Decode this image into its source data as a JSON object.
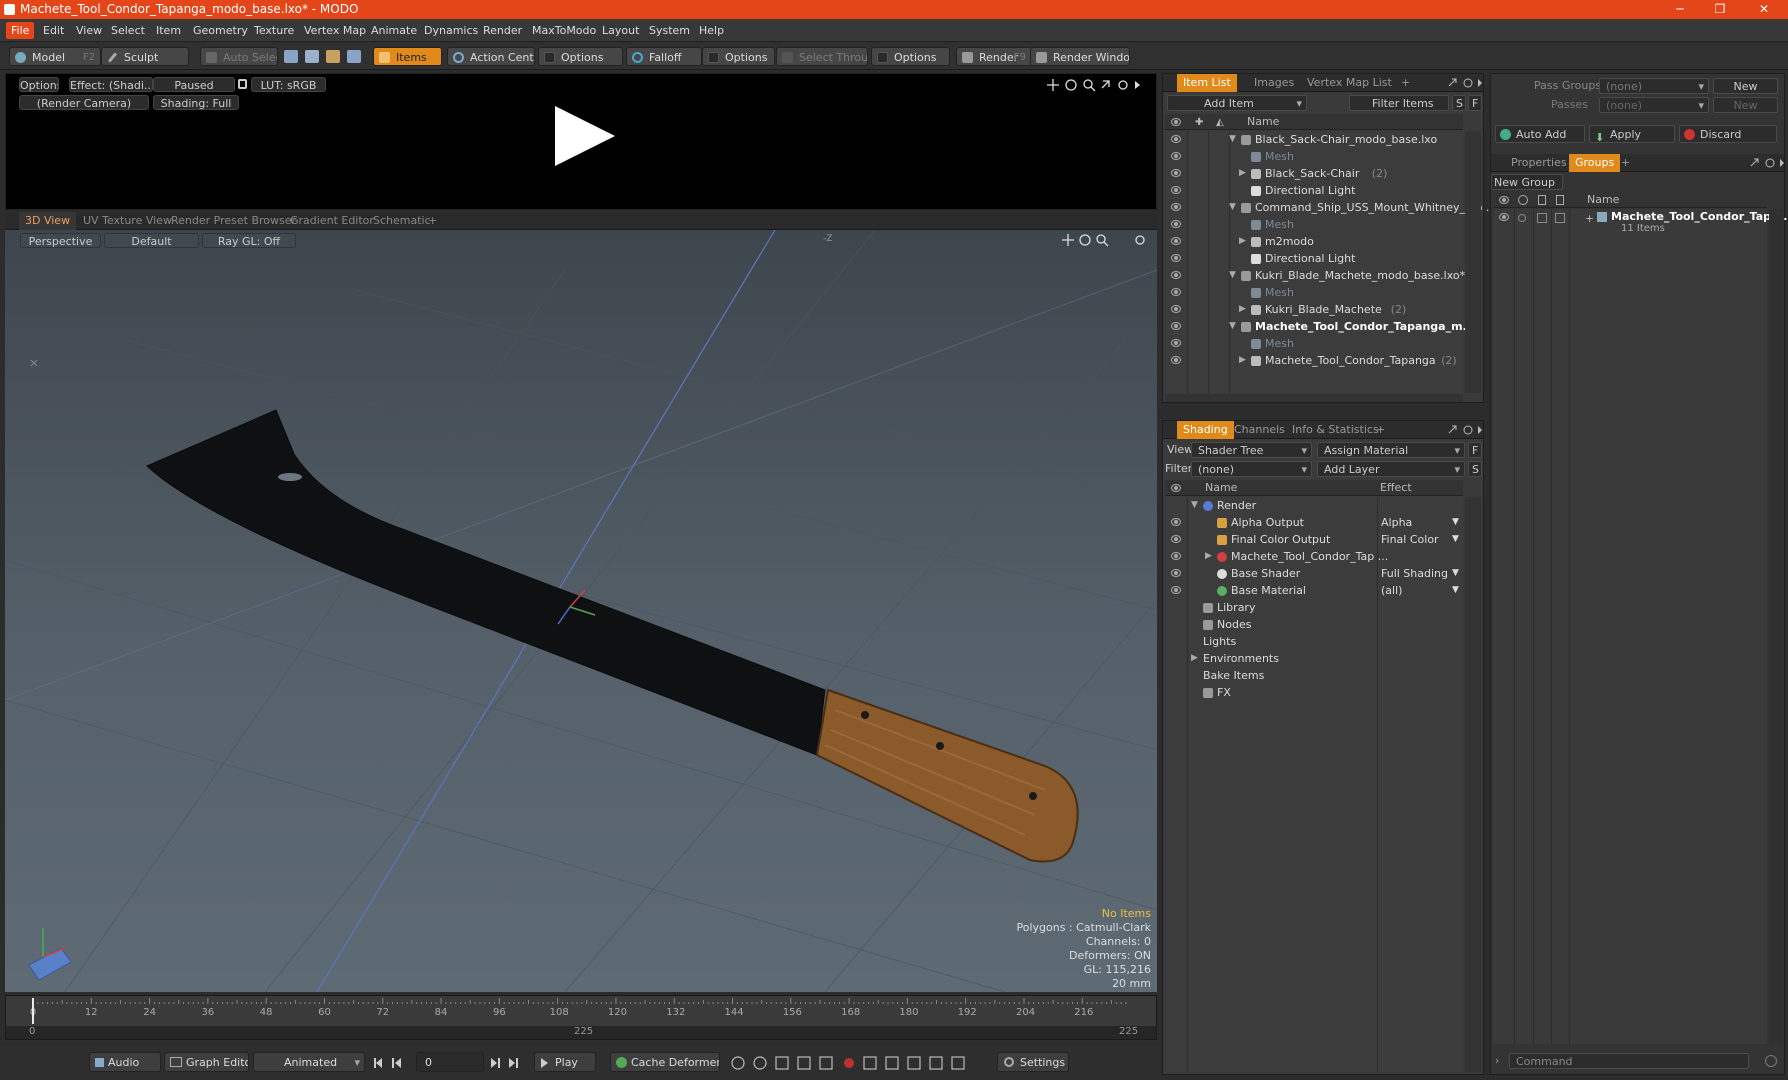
{
  "window": {
    "title": "Machete_Tool_Condor_Tapanga_modo_base.lxo* - MODO",
    "minimize": "─",
    "maximize": "❐",
    "close": "✕"
  },
  "menu": [
    "File",
    "Edit",
    "View",
    "Select",
    "Item",
    "Geometry",
    "Texture",
    "Vertex Map",
    "Animate",
    "Dynamics",
    "Render",
    "MaxToModo",
    "Layout",
    "System",
    "Help"
  ],
  "toolbar": {
    "model": "Model",
    "model_key": "F2",
    "sculpt": "Sculpt",
    "auto_select": "Auto Select",
    "items": "Items",
    "action_center": "Action Center",
    "options1": "Options",
    "falloff": "Falloff",
    "options2": "Options",
    "select_through": "Select Through",
    "options3": "Options",
    "render": "Render",
    "render_key": "F9",
    "render_window": "Render Window"
  },
  "preview": {
    "options": "Options",
    "effect": "Effect: (Shadi...",
    "paused": "Paused",
    "lut": "LUT: sRGB",
    "camera": "(Render Camera)",
    "shading": "Shading: Full"
  },
  "viewport_tabs": [
    "3D View",
    "UV Texture View",
    "Render Preset Browser",
    "Gradient Editor",
    "Schematic",
    "+"
  ],
  "viewport": {
    "perspective": "Perspective",
    "default": "Default",
    "raygl": "Ray GL: Off",
    "axis_label": "-Z",
    "stats": [
      "No Items",
      "Polygons : Catmull-Clark",
      "Channels: 0",
      "Deformers: ON",
      "GL: 115,216",
      "20 mm"
    ]
  },
  "timeline": {
    "ticks": [
      "0",
      "12",
      "24",
      "36",
      "48",
      "60",
      "72",
      "84",
      "96",
      "108",
      "120",
      "132",
      "144",
      "156",
      "168",
      "180",
      "192",
      "204",
      "216"
    ],
    "start": "0",
    "mid": "225",
    "end": "225"
  },
  "bottom": {
    "audio": "Audio",
    "graph_editor": "Graph Editor",
    "animated": "Animated",
    "frame": "0",
    "play": "Play",
    "cache": "Cache Deformers",
    "settings": "Settings"
  },
  "item_list": {
    "tabs": [
      "Item List",
      "Images",
      "Vertex Map List",
      "+"
    ],
    "add_item": "Add Item",
    "filter": "Filter Items",
    "s": "S",
    "f": "F",
    "col_name": "Name",
    "rows": [
      {
        "label": "Black_Sack-Chair_modo_base.lxo",
        "indent": 0,
        "type": "scene",
        "dim": false,
        "bold": false
      },
      {
        "label": "Mesh",
        "indent": 1,
        "type": "mesh",
        "dim": true,
        "bold": false
      },
      {
        "label": "Black_Sack-Chair",
        "suffix": "(2)",
        "indent": 1,
        "type": "group",
        "dim": false,
        "bold": false
      },
      {
        "label": "Directional Light",
        "indent": 1,
        "type": "light",
        "dim": false,
        "bold": false
      },
      {
        "label": "Command_Ship_USS_Mount_Whitney_mo ...",
        "indent": 0,
        "type": "scene",
        "dim": false,
        "bold": false
      },
      {
        "label": "Mesh",
        "indent": 1,
        "type": "mesh",
        "dim": true,
        "bold": false
      },
      {
        "label": "m2modo",
        "indent": 1,
        "type": "group",
        "dim": false,
        "bold": false
      },
      {
        "label": "Directional Light",
        "indent": 1,
        "type": "light",
        "dim": false,
        "bold": false
      },
      {
        "label": "Kukri_Blade_Machete_modo_base.lxo*",
        "indent": 0,
        "type": "scene",
        "dim": false,
        "bold": false
      },
      {
        "label": "Mesh",
        "indent": 1,
        "type": "mesh",
        "dim": true,
        "bold": false
      },
      {
        "label": "Kukri_Blade_Machete",
        "suffix": "(2)",
        "indent": 1,
        "type": "group",
        "dim": false,
        "bold": false
      },
      {
        "label": "Machete_Tool_Condor_Tapanga_m...",
        "indent": 0,
        "type": "scene",
        "dim": false,
        "bold": true
      },
      {
        "label": "Mesh",
        "indent": 1,
        "type": "mesh",
        "dim": true,
        "bold": false
      },
      {
        "label": "Machete_Tool_Condor_Tapanga",
        "suffix": "(2)",
        "indent": 1,
        "type": "group",
        "dim": false,
        "bold": false
      }
    ]
  },
  "shading": {
    "tabs": [
      "Shading",
      "Channels",
      "Info & Statistics",
      "+"
    ],
    "view_label": "View",
    "view_value": "Shader Tree",
    "assign": "Assign Material",
    "f": "F",
    "filter_label": "Filter",
    "filter_value": "(none)",
    "add_layer": "Add Layer",
    "s": "S",
    "col_name": "Name",
    "col_effect": "Effect",
    "rows": [
      {
        "label": "Render",
        "effect": "",
        "indent": 0,
        "icon": "render"
      },
      {
        "label": "Alpha Output",
        "effect": "Alpha",
        "indent": 1,
        "icon": "output"
      },
      {
        "label": "Final Color Output",
        "effect": "Final Color",
        "indent": 1,
        "icon": "output"
      },
      {
        "label": "Machete_Tool_Condor_Tap ...",
        "effect": "",
        "indent": 1,
        "icon": "material"
      },
      {
        "label": "Base Shader",
        "effect": "Full Shading",
        "indent": 1,
        "icon": "shader"
      },
      {
        "label": "Base Material",
        "effect": "(all)",
        "indent": 1,
        "icon": "basematerial"
      },
      {
        "label": "Library",
        "effect": "",
        "indent": 0,
        "icon": "folder"
      },
      {
        "label": "Nodes",
        "effect": "",
        "indent": 0,
        "icon": "folder"
      },
      {
        "label": "Lights",
        "effect": "",
        "indent": 0,
        "icon": "none"
      },
      {
        "label": "Environments",
        "effect": "",
        "indent": 0,
        "icon": "none"
      },
      {
        "label": "Bake Items",
        "effect": "",
        "indent": 0,
        "icon": "none"
      },
      {
        "label": "FX",
        "effect": "",
        "indent": 0,
        "icon": "fx"
      }
    ]
  },
  "right_panel": {
    "pass_groups": "Pass Groups",
    "pass_value": "(none)",
    "new": "New",
    "passes": "Passes",
    "passes_value": "(none)",
    "new2": "New",
    "auto_add": "Auto Add",
    "apply": "Apply",
    "discard": "Discard",
    "tabs": [
      "Properties",
      "Groups",
      "+"
    ],
    "new_group": "New Group",
    "col_name": "Name",
    "group_name": "Machete_Tool_Condor_Tap ...",
    "group_count": "11 Items",
    "command": "Command"
  },
  "colors": {
    "accent": "#e4461a",
    "tab_active": "#e08a1c"
  }
}
